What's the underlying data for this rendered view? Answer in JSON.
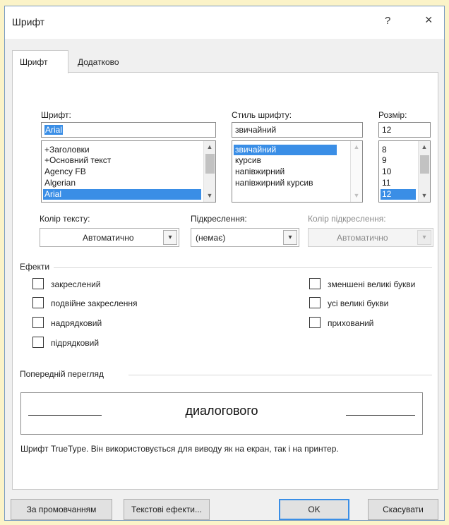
{
  "window": {
    "title": "Шрифт",
    "help": "?",
    "close": "×"
  },
  "tabs": [
    {
      "label": "Шрифт",
      "active": true
    },
    {
      "label": "Додатково",
      "active": false
    }
  ],
  "font": {
    "label": "Шрифт:",
    "value": "Arial",
    "list": [
      "+Заголовки",
      "+Основний текст",
      "Agency FB",
      "Algerian",
      "Arial"
    ],
    "selected": "Arial"
  },
  "style": {
    "label": "Стиль шрифту:",
    "value": "звичайний",
    "list": [
      "звичайний",
      "курсив",
      "напівжирний",
      "напівжирний курсив"
    ],
    "selected": "звичайний"
  },
  "size": {
    "label": "Розмір:",
    "value": "12",
    "list": [
      "8",
      "9",
      "10",
      "11",
      "12"
    ],
    "selected": "12"
  },
  "font_color": {
    "label": "Колір тексту:",
    "value": "Автоматично"
  },
  "underline": {
    "label": "Підкреслення:",
    "value": "(немає)"
  },
  "underline_color": {
    "label": "Колір підкреслення:",
    "value": "Автоматично",
    "enabled": false
  },
  "effects": {
    "label": "Ефекти",
    "left": [
      {
        "label": "закреслений",
        "checked": false
      },
      {
        "label": "подвійне закреслення",
        "checked": false
      },
      {
        "label": "надрядковий",
        "checked": false
      },
      {
        "label": "підрядковий",
        "checked": false
      }
    ],
    "right": [
      {
        "label": "зменшені великі букви",
        "checked": false
      },
      {
        "label": "усі великі букви",
        "checked": false
      },
      {
        "label": "прихований",
        "checked": false
      }
    ]
  },
  "preview": {
    "label": "Попередній перегляд",
    "text": "диалогового",
    "description": "Шрифт TrueType. Він використовується для виводу як на екран, так і на принтер."
  },
  "buttons": {
    "default": "За промовчанням",
    "text_effects": "Текстові ефекти...",
    "ok": "OK",
    "cancel": "Скасувати"
  },
  "colors": {
    "accent": "#3a8ee6",
    "background": "#fbf3c8"
  }
}
